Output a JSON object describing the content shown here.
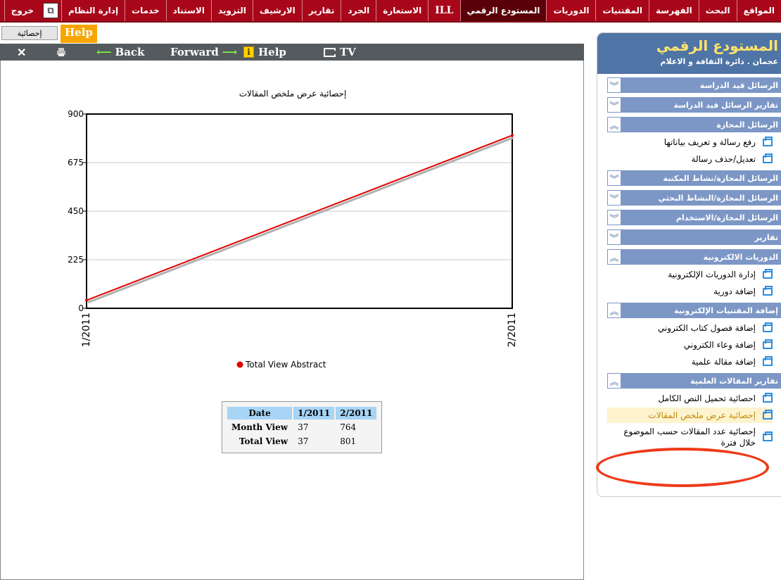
{
  "topnav": {
    "items": [
      {
        "label": "المواقع"
      },
      {
        "label": "البحث"
      },
      {
        "label": "الفهرسة"
      },
      {
        "label": "المقتنيات"
      },
      {
        "label": "الدوريات"
      },
      {
        "label": "المستودع الرقمي"
      },
      {
        "label": "ILL"
      },
      {
        "label": "الاستعارة"
      },
      {
        "label": "الجرد"
      },
      {
        "label": "تقارير"
      },
      {
        "label": "الارشيف"
      },
      {
        "label": "التزويد"
      },
      {
        "label": "الاستناد"
      },
      {
        "label": "خدمات"
      },
      {
        "label": "إدارة النظام"
      },
      {
        "label": "خروج"
      }
    ],
    "active_index": 5
  },
  "tabs": {
    "stats_label": "إحصائية",
    "help_label": "Help"
  },
  "toolbar": {
    "back_label": "Back",
    "forward_label": "Forward",
    "help_label": "Help",
    "tv_label": "TV"
  },
  "chart_data": {
    "type": "line",
    "title": "إحصائية عرض ملخص المقالات",
    "x_categories": [
      "1/2011",
      "2/2011"
    ],
    "series": [
      {
        "name": "Total View Abstract",
        "values": [
          37,
          801
        ],
        "color": "#e00000"
      }
    ],
    "y_ticks": [
      "0",
      "225",
      "450",
      "675",
      "900"
    ],
    "ylim": [
      0,
      900
    ],
    "grid": true,
    "legend": "bottom"
  },
  "data_table": {
    "headers": [
      "Date",
      "1/2011",
      "2/2011"
    ],
    "rows": [
      {
        "label": "Month View",
        "values": [
          "37",
          "764"
        ]
      },
      {
        "label": "Total View",
        "values": [
          "37",
          "801"
        ]
      }
    ]
  },
  "sidebar": {
    "title": "المستودع الرقمي",
    "subtitle": "عجمان . دائرة الثقافة و الاعلام",
    "groups": [
      {
        "label": "الرسائل قيد الدراسة",
        "expanded": false,
        "items": []
      },
      {
        "label": "تقارير الرسائل قيد الدراسة",
        "expanded": false,
        "items": []
      },
      {
        "label": "الرسائل المجازة",
        "expanded": true,
        "items": [
          {
            "label": "رفع رسالة و تعريف بياناتها"
          },
          {
            "label": "تعديل/حذف رسالة"
          }
        ]
      },
      {
        "label": "الرسائل المجازة/نشاط المكتبة",
        "expanded": false,
        "items": []
      },
      {
        "label": "الرسائل المجازة/النشاط البحثي",
        "expanded": false,
        "items": []
      },
      {
        "label": "الرسائل المجازة/الاستخدام",
        "expanded": false,
        "items": []
      },
      {
        "label": "تقارير",
        "expanded": false,
        "items": []
      },
      {
        "label": "الدوريات الالكترونية",
        "expanded": true,
        "items": [
          {
            "label": "إدارة الدوريات الإلكترونية"
          },
          {
            "label": "إضافة دورية"
          }
        ]
      },
      {
        "label": "إضافة المقتنيات الإلكترونية",
        "expanded": true,
        "items": [
          {
            "label": "إضافة فصول كتاب الكتروني"
          },
          {
            "label": "إضافة وعاء الكتروني"
          },
          {
            "label": "إضافة مقالة علمية"
          }
        ]
      },
      {
        "label": "تقارير المقالات العلمية",
        "expanded": true,
        "items": [
          {
            "label": "احصائية تحميل النص الكامل"
          },
          {
            "label": "إحصائية عرض ملخص المقالات",
            "active": true
          },
          {
            "label": "إحصائية عدد المقالات حسب الموضوع خلال فترة",
            "tall": true
          }
        ]
      }
    ]
  },
  "colors": {
    "nav_bg": "#a8071a",
    "nav_active": "#5a0009",
    "sidebar_header": "#4f74a6",
    "group_bar": "#7c97c6",
    "series_line": "#e00000",
    "highlight_ring": "#ee3a18"
  }
}
